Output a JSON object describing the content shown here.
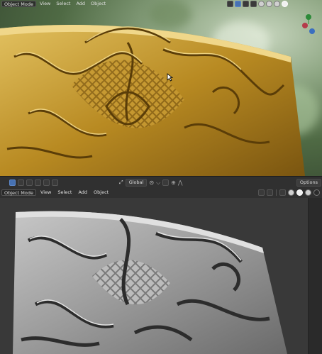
{
  "top_header": {
    "mode_label": "Object Mode",
    "menus": [
      "View",
      "Select",
      "Add",
      "Object"
    ]
  },
  "bottom_header": {
    "mode_label": "Object Mode",
    "menus": [
      "View",
      "Select",
      "Add",
      "Object"
    ],
    "transform_orientation": "Global",
    "options_label": "Options"
  },
  "colors": {
    "gold": "#c9a030",
    "gold_dark": "#6b4a0c",
    "gray_relief": "#8a8a8a",
    "accent": "#4772b3"
  },
  "icons": [
    "cursor-icon",
    "select-box-icon",
    "pivot-icon",
    "snap-icon",
    "proportional-edit-icon",
    "viewport-shading-icon",
    "navigation-gizmo"
  ]
}
